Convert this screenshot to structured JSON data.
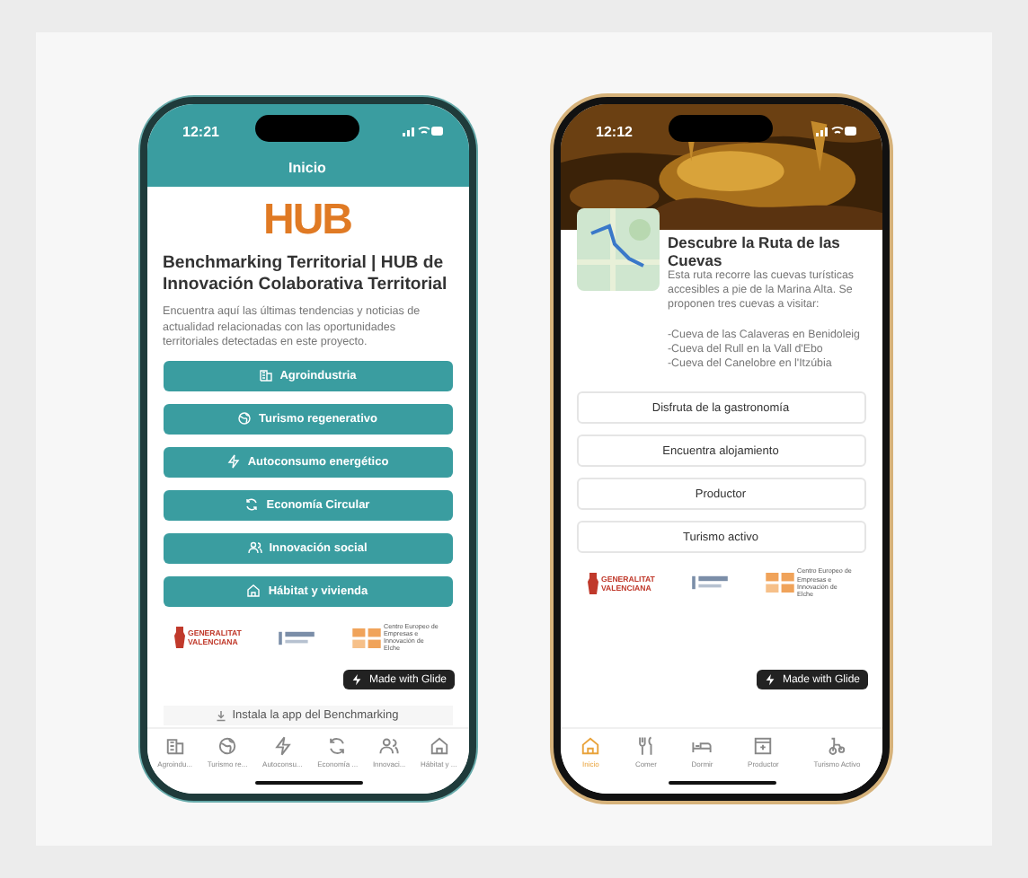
{
  "phones": [
    {
      "kind": "list",
      "time": "12:21",
      "header": "Inicio",
      "logo": "HUB",
      "title": "Benchmarking Territorial | HUB de Innovación Colaborativa Territorial",
      "description": "Encuentra aquí las últimas tendencias y noticias de actualidad relacionadas con las oportunidades territoriales detectadas en este proyecto.",
      "buttons": [
        {
          "label": "Agroindustria",
          "kind": "building"
        },
        {
          "label": "Turismo regenerativo",
          "kind": "globe"
        },
        {
          "label": "Autoconsumo energético",
          "kind": "bolt"
        },
        {
          "label": "Economía Circular",
          "kind": "cycle"
        },
        {
          "label": "Innovación social",
          "kind": "people"
        },
        {
          "label": "Hábitat y vivienda",
          "kind": "house"
        }
      ],
      "sponsors": [
        "GENERALITAT VALENCIANA",
        "Centro Europeo de Empresas e Innovación de Elche"
      ],
      "badge": "Made with Glide",
      "install": "Instala la app del Benchmarking",
      "tabs": [
        {
          "label": "Agroindu...",
          "kind": "building",
          "selected": false
        },
        {
          "label": "Turismo re...",
          "kind": "globe",
          "selected": false
        },
        {
          "label": "Autoconsu...",
          "kind": "bolt",
          "selected": false
        },
        {
          "label": "Economía ...",
          "kind": "cycle",
          "selected": false
        },
        {
          "label": "Innovaci...",
          "kind": "people",
          "selected": false
        },
        {
          "label": "Hábitat y ...",
          "kind": "house",
          "selected": false
        }
      ]
    },
    {
      "kind": "detail",
      "time": "12:12",
      "title": "Descubre la Ruta de las Cuevas",
      "description": "Esta ruta recorre las cuevas turísticas accesibles a pie de la Marina Alta. Se proponen tres cuevas a visitar:",
      "lines": [
        "-Cueva de las Calaveras en Benidoleig",
        "-Cueva del Rull en la Vall d'Ebo",
        "-Cueva del Canelobre en l'Itzúbia"
      ],
      "buttons": [
        {
          "label": "Disfruta de la gastronomía"
        },
        {
          "label": "Encuentra alojamiento"
        },
        {
          "label": "Productor"
        },
        {
          "label": "Turismo activo"
        }
      ],
      "sponsors": [
        "GENERALITAT VALENCIANA",
        "Centro Europeo de Empresas e Innovación de Elche"
      ],
      "badge": "Made with Glide",
      "tabs": [
        {
          "label": "Inicio",
          "kind": "house",
          "selected": true
        },
        {
          "label": "Comer",
          "kind": "fork",
          "selected": false
        },
        {
          "label": "Dormir",
          "kind": "bed",
          "selected": false
        },
        {
          "label": "Productor",
          "kind": "box",
          "selected": false
        },
        {
          "label": "Turismo Activo",
          "kind": "bike",
          "selected": false
        }
      ]
    }
  ]
}
